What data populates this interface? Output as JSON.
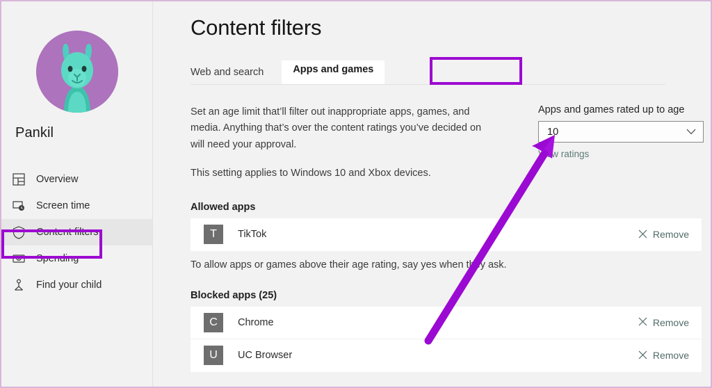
{
  "sidebar": {
    "profile_name": "Pankil",
    "avatar_icon": "llama-avatar",
    "items": [
      {
        "label": "Overview",
        "icon": "dashboard-grid-icon"
      },
      {
        "label": "Screen time",
        "icon": "monitor-clock-icon"
      },
      {
        "label": "Content filters",
        "icon": "shield-icon"
      },
      {
        "label": "Spending",
        "icon": "banknote-icon"
      },
      {
        "label": "Find your child",
        "icon": "person-pin-icon"
      }
    ],
    "active_item": "Content filters"
  },
  "main": {
    "page_title": "Content filters",
    "tabs": [
      {
        "label": "Web and search",
        "selected": false
      },
      {
        "label": "Apps and games",
        "selected": true
      }
    ],
    "description_1": "Set an age limit that’ll filter out inappropriate apps, games, and media. Anything that’s over the content ratings you’ve decided on will need your approval.",
    "description_2": "This setting applies to Windows 10 and Xbox devices.",
    "age_limit": {
      "label": "Apps and games rated up to age",
      "value": "10",
      "chevron_icon": "chevron-down-icon",
      "link_label": "View ratings"
    },
    "allowed": {
      "title": "Allowed apps",
      "apps": [
        {
          "initial": "T",
          "name": "TikTok",
          "action": "Remove",
          "action_icon": "close-x-icon"
        }
      ],
      "note": "To allow apps or games above their age rating, say yes when they ask."
    },
    "blocked": {
      "title": "Blocked apps (25)",
      "apps": [
        {
          "initial": "C",
          "name": "Chrome",
          "action": "Remove",
          "action_icon": "close-x-icon"
        },
        {
          "initial": "U",
          "name": "UC Browser",
          "action": "Remove",
          "action_icon": "close-x-icon"
        }
      ]
    }
  },
  "annotations": {
    "accent_color": "#9d0ad1",
    "arrow_icon": "pointer-arrow-annotation",
    "highlight_targets": [
      "Apps and games",
      "Content filters"
    ]
  },
  "colors": {
    "accent": "#9d0ad1",
    "sidebar_bg": "#f2f2f2",
    "card_bg": "#ffffff",
    "avatar_bg": "#ad73bd",
    "avatar_fg": "#4ecdc0",
    "app_tile": "#6e6e6e",
    "link": "#5c7a76",
    "frame_border": "#d8b6d8"
  }
}
